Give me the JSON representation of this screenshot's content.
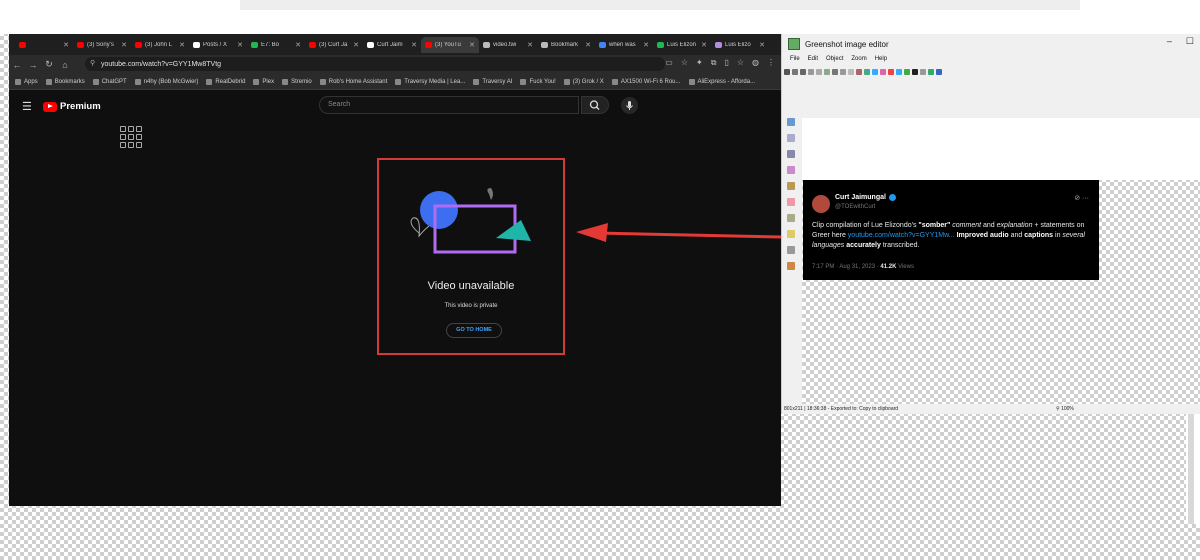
{
  "browser": {
    "tabs": [
      {
        "label": "",
        "fav": "#ff0000"
      },
      {
        "label": "(3) Sony's",
        "fav": "#ff0000"
      },
      {
        "label": "(3) John L",
        "fav": "#ff0000"
      },
      {
        "label": "Posts / X",
        "fav": "#ffffff"
      },
      {
        "label": "E7: Bo",
        "fav": "#1db954"
      },
      {
        "label": "(3) Curt Ja",
        "fav": "#ff0000"
      },
      {
        "label": "Curt Jaim",
        "fav": "#ffffff"
      },
      {
        "label": "(3) YouTu",
        "fav": "#ff0000",
        "active": true
      },
      {
        "label": "video.twi",
        "fav": "#bbbbbb"
      },
      {
        "label": "Bookmark",
        "fav": "#bbbbbb"
      },
      {
        "label": "when was",
        "fav": "#4285f4"
      },
      {
        "label": "Luis Elizon",
        "fav": "#1db954"
      },
      {
        "label": "Luis Elizo",
        "fav": "#b48ede"
      }
    ],
    "url": "youtube.com/watch?v=GYY1Mw8TVtg",
    "bookmarks": [
      "Apps",
      "Bookmarks",
      "ChatGPT",
      "n4hy (Bob McGwier)",
      "RealDebrid",
      "Plex",
      "Stremio",
      "Rob's Home Assistant",
      "Traversy Media | Lea...",
      "Traversy AI",
      "Fuck You!",
      "(3) Grok / X",
      "AX1500 Wi-Fi 6 Rou...",
      "AliExpress - Afforda..."
    ]
  },
  "youtube": {
    "logo_text": "Premium",
    "search_placeholder": "Search",
    "error_title": "Video unavailable",
    "error_subtitle": "This video is private",
    "go_home_label": "GO TO HOME"
  },
  "greenshot": {
    "title": "Greenshot image editor",
    "menu": [
      "File",
      "Edit",
      "Object",
      "Zoom",
      "Help"
    ],
    "status_left": "801x211 | 18:36:38 - Exported to: Copy to clipboard",
    "status_zoom": "100%",
    "tweet": {
      "name": "Curt Jaimungal",
      "handle": "@TOEwithCurt",
      "body_1": "Clip compilation of Lue Elizondo's ",
      "body_somber": "\"somber\"",
      "body_2": " comment",
      "body_3": " and ",
      "body_explanation": "explanation",
      "body_4": " + statements on Greer here ",
      "body_link": "youtube.com/watch?v=GYY1Mw...",
      "body_improved": "Improved audio",
      "body_5": " and ",
      "body_captions": "captions",
      "body_6": " in ",
      "body_languages": "several languages",
      "body_accurately": "accurately",
      "body_7": " transcribed.",
      "meta_time": "7:17 PM · Aug 31, 2023 · ",
      "meta_views": "41.2K",
      "meta_views_label": " Views"
    }
  },
  "colors": {
    "annotation_red": "#e53935",
    "yt_red": "#ff0000",
    "link_blue": "#3ea6ff"
  }
}
